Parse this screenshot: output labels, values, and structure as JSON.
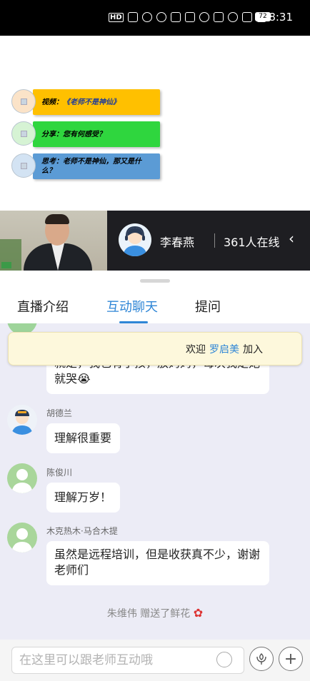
{
  "status_bar": {
    "time": "8:31",
    "battery": "72",
    "network": "HD 5G"
  },
  "slide": {
    "items": [
      {
        "label": "视频：",
        "emph": "《老师不是神仙》",
        "color": "#ffc000"
      },
      {
        "label": "分享：您有何感受？",
        "emph": "",
        "color": "#2fd63e"
      },
      {
        "label": "思考：老师不是神仙，那又是什么？",
        "emph": "",
        "color": "#5b9bd5"
      }
    ]
  },
  "live": {
    "host_name": "李春燕",
    "online": "361人在线",
    "back_icon": "chevron-left-icon"
  },
  "tabs": [
    {
      "label": "直播介绍",
      "active": false
    },
    {
      "label": "互动聊天",
      "active": true
    },
    {
      "label": "提问",
      "active": false
    }
  ],
  "welcome": {
    "prefix": "欢迎",
    "name": "罗启美",
    "suffix": "加入"
  },
  "messages": [
    {
      "name": "",
      "text": "就是，我也有小孩，放妈妈，每次我走她就哭😭"
    },
    {
      "name": "胡德兰",
      "text": "理解很重要"
    },
    {
      "name": "陈俊川",
      "text": "理解万岁！"
    },
    {
      "name": "木克热木·马合木提",
      "text": "虽然是远程培训，但是收获真不少，谢谢老师们"
    }
  ],
  "gift": {
    "text": "朱维伟 赠送了鲜花"
  },
  "input": {
    "placeholder": "在这里可以跟老师互动哦"
  },
  "colors": {
    "accent": "#2f86d6",
    "chat_bg": "#ececf6"
  }
}
